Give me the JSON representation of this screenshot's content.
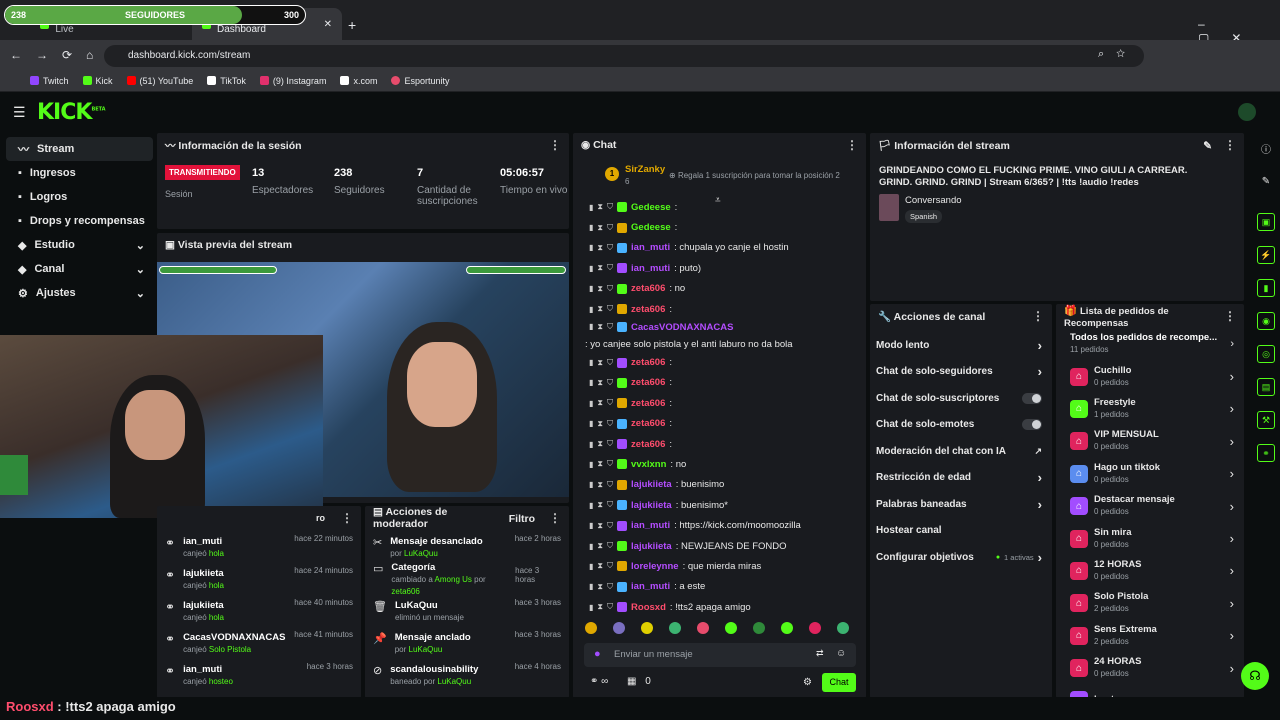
{
  "overlay": {
    "left": "238",
    "label": "SEGUIDORES",
    "right": "300",
    "progress": 0.79
  },
  "browser": {
    "tabs": [
      {
        "label": "Just Chatting Streaming - Live"
      },
      {
        "label": "Stream - Kick Dashboard"
      }
    ],
    "url": "dashboard.kick.com/stream",
    "bookmarks": [
      {
        "label": "Twitch",
        "color": "#9146ff"
      },
      {
        "label": "Kick",
        "color": "#53fc18"
      },
      {
        "label": "(51) YouTube",
        "color": "#ff0000"
      },
      {
        "label": "TikTok",
        "color": "#ffffff"
      },
      {
        "label": "(9) Instagram",
        "color": "#e1306c"
      },
      {
        "label": "x.com",
        "color": "#ffffff"
      },
      {
        "label": "Esportunity",
        "color": "#e74c6c"
      }
    ]
  },
  "brand": {
    "logo": "KICK",
    "beta": "BETA"
  },
  "sidebar": {
    "items": [
      {
        "label": "Stream",
        "icon": "stream-icon"
      },
      {
        "label": "Ingresos",
        "icon": "money-icon"
      },
      {
        "label": "Logros",
        "icon": "trophy-icon"
      },
      {
        "label": "Drops y recompensas",
        "icon": "gift-icon"
      },
      {
        "label": "Estudio",
        "icon": "studio-icon"
      },
      {
        "label": "Canal",
        "icon": "channel-icon"
      },
      {
        "label": "Ajustes",
        "icon": "gear-icon"
      }
    ]
  },
  "session": {
    "title": "Información de la sesión",
    "status": "TRANSMITIENDO",
    "status_label": "Sesión",
    "stats": [
      {
        "value": "13",
        "label": "Espectadores"
      },
      {
        "value": "238",
        "label": "Seguidores"
      },
      {
        "value": "7",
        "label": "Cantidad de suscripciones"
      },
      {
        "value": "05:06:57",
        "label": "Tiempo en vivo"
      }
    ]
  },
  "preview": {
    "title": "Vista previa del stream"
  },
  "chat": {
    "title": "Chat",
    "pinned": {
      "rank": "1",
      "user": "SirZanky",
      "sub": "6",
      "promo": "Regala 1 suscripción para tomar la posición 2"
    },
    "messages": [
      {
        "user": "Gedeese",
        "color": "#53fc18",
        "text": ": "
      },
      {
        "user": "Gedeese",
        "color": "#53fc18",
        "text": ": "
      },
      {
        "user": "ian_muti",
        "color": "#b44dff",
        "text": ": chupala yo canje el hostin"
      },
      {
        "user": "ian_muti",
        "color": "#b44dff",
        "text": ": puto)"
      },
      {
        "user": "zeta606",
        "color": "#ff4d6d",
        "text": ": no"
      },
      {
        "user": "zeta606",
        "color": "#ff4d6d",
        "text": ": "
      },
      {
        "user": "CacasVODNAXNACAS",
        "color": "#b44dff",
        "text": ": yo canjee solo pistola y el anti laburo no da bola"
      },
      {
        "user": "zeta606",
        "color": "#ff4d6d",
        "text": ": "
      },
      {
        "user": "zeta606",
        "color": "#ff4d6d",
        "text": ": "
      },
      {
        "user": "zeta606",
        "color": "#ff4d6d",
        "text": ": "
      },
      {
        "user": "zeta606",
        "color": "#ff4d6d",
        "text": ": "
      },
      {
        "user": "zeta606",
        "color": "#ff4d6d",
        "text": ": "
      },
      {
        "user": "vvxlxnn",
        "color": "#53fc18",
        "text": ": no"
      },
      {
        "user": "lajukiieta",
        "color": "#b44dff",
        "text": ": buenisimo"
      },
      {
        "user": "lajukiieta",
        "color": "#b44dff",
        "text": ": buenisimo*"
      },
      {
        "user": "ian_muti",
        "color": "#b44dff",
        "text": ": https://kick.com/moomoozilla"
      },
      {
        "user": "lajukiieta",
        "color": "#b44dff",
        "text": ": NEWJEANS DE FONDO"
      },
      {
        "user": "loreleynne",
        "color": "#b44dff",
        "text": ": que mierda miras"
      },
      {
        "user": "ian_muti",
        "color": "#b44dff",
        "text": ": a este"
      },
      {
        "user": "Roosxd",
        "color": "#ff4d6d",
        "text": ": !tts2 apaga amigo"
      }
    ],
    "input_placeholder": "Enviar un mensaje",
    "count": "0",
    "send": "Chat"
  },
  "stream_info": {
    "title": "Información del stream",
    "stream_title": "GRINDEANDO COMO EL FUCKING PRIME. VINO GIULI A CARREAR. GRIND. GRIND. GRIND | Stream 6/365? | !tts !audio !redes",
    "category": "Conversando",
    "language": "Spanish"
  },
  "channel_actions": {
    "title": "Acciones de canal",
    "items": [
      {
        "label": "Modo lento",
        "ctrl": "chevron"
      },
      {
        "label": "Chat de solo-seguidores",
        "ctrl": "chevron"
      },
      {
        "label": "Chat de solo-suscriptores",
        "ctrl": "toggle"
      },
      {
        "label": "Chat de solo-emotes",
        "ctrl": "toggle"
      },
      {
        "label": "Moderación del chat con IA",
        "ctrl": "external"
      },
      {
        "label": "Restricción de edad",
        "ctrl": "chevron"
      },
      {
        "label": "Palabras baneadas",
        "ctrl": "chevron"
      },
      {
        "label": "Hostear canal",
        "ctrl": "none"
      },
      {
        "label": "Configurar objetivos",
        "ctrl": "chevron",
        "extra": "1 activas"
      }
    ]
  },
  "rewards": {
    "title": "Lista de pedidos de Recompensas",
    "all": {
      "label": "Todos los pedidos de recompe...",
      "count": "11 pedidos"
    },
    "items": [
      {
        "label": "Cuchillo",
        "count": "0 pedidos",
        "color": "#e0245e"
      },
      {
        "label": "Freestyle",
        "count": "1 pedidos",
        "color": "#53fc18"
      },
      {
        "label": "VIP MENSUAL",
        "count": "0 pedidos",
        "color": "#e0245e"
      },
      {
        "label": "Hago un tiktok",
        "count": "0 pedidos",
        "color": "#5b8def"
      },
      {
        "label": "Destacar mensaje",
        "count": "0 pedidos",
        "color": "#a24dff"
      },
      {
        "label": "Sin mira",
        "count": "0 pedidos",
        "color": "#e0245e"
      },
      {
        "label": "12 HORAS",
        "count": "0 pedidos",
        "color": "#e0245e"
      },
      {
        "label": "Solo Pistola",
        "count": "2 pedidos",
        "color": "#e0245e"
      },
      {
        "label": "Sens Extrema",
        "count": "2 pedidos",
        "color": "#e0245e"
      },
      {
        "label": "24 HORAS",
        "count": "0 pedidos",
        "color": "#e0245e"
      },
      {
        "label": "hostes",
        "count": "",
        "color": "#a24dff"
      }
    ]
  },
  "redemptions": [
    {
      "user": "ian_muti",
      "action": "canjeó",
      "reward": "hola",
      "time": "hace 22 minutos"
    },
    {
      "user": "lajukiieta",
      "action": "canjeó",
      "reward": "hola",
      "time": "hace 24 minutos"
    },
    {
      "user": "lajukiieta",
      "action": "canjeó",
      "reward": "hola",
      "time": "hace 40 minutos"
    },
    {
      "user": "CacasVODNAXNACAS",
      "action": "canjeó",
      "reward": "Solo Pistola",
      "time": "hace 41 minutos"
    },
    {
      "user": "ian_muti",
      "action": "canjeó",
      "reward": "hosteo",
      "time": "hace 3 horas"
    }
  ],
  "redemptions_tab": "ro",
  "mod_actions": {
    "title": "Acciones de moderador",
    "filter": "Filtro",
    "items": [
      {
        "title": "Mensaje desanclado",
        "detail": "por ",
        "who": "LuKaQuu",
        "time": "hace 2 horas",
        "icon": "unpin-icon"
      },
      {
        "title": "Categoría",
        "detail": "cambiado a ",
        "who": "Among Us",
        "by": " por ",
        "who2": "zeta606",
        "time": "hace 3 horas",
        "icon": "category-icon"
      },
      {
        "title": "LuKaQuu",
        "detail": "eliminó un mensaje",
        "who": "",
        "time": "hace 3 horas",
        "icon": "trash-icon"
      },
      {
        "title": "Mensaje anclado",
        "detail": "por ",
        "who": "LuKaQuu",
        "time": "hace 3 horas",
        "icon": "pin-icon"
      },
      {
        "title": "scandalousinability",
        "detail": "baneado por ",
        "who": "LuKaQuu",
        "time": "hace 4 horas",
        "icon": "ban-icon"
      }
    ]
  },
  "caption": {
    "user": "Roosxd",
    "text": " : !tts2 apaga amigo"
  }
}
